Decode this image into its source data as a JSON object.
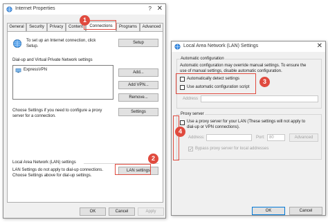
{
  "internet_properties": {
    "title": "Internet Properties",
    "help_glyph": "?",
    "close_glyph": "✕",
    "tabs": [
      {
        "label": "General"
      },
      {
        "label": "Security"
      },
      {
        "label": "Privacy"
      },
      {
        "label": "Content"
      },
      {
        "label": "Connections"
      },
      {
        "label": "Programs"
      },
      {
        "label": "Advanced"
      }
    ],
    "setup_text_1": "To set up an Internet connection, click",
    "setup_text_2": "Setup.",
    "setup_button": "Setup",
    "dialup_heading": "Dial-up and Virtual Private Network settings",
    "vpn_item": "ExpressVPN",
    "add_button": "Add...",
    "add_vpn_button": "Add VPN...",
    "remove_button": "Remove...",
    "settings_button": "Settings",
    "proxy_text_1": "Choose Settings if you need to configure a proxy",
    "proxy_text_2": "server for a connection.",
    "lan_heading": "Local Area Network (LAN) settings",
    "lan_text_1": "LAN Settings do not apply to dial-up connections.",
    "lan_text_2": "Choose Settings above for dial-up settings.",
    "lan_button": "LAN settings",
    "ok_button": "OK",
    "cancel_button": "Cancel",
    "apply_button": "Apply"
  },
  "lan_dialog": {
    "title": "Local Area Network (LAN) Settings",
    "close_glyph": "✕",
    "auto_config_heading": "Automatic configuration",
    "auto_config_text_1": "Automatic configuration may override manual settings. To ensure the",
    "auto_config_text_2": "use of manual settings, disable automatic configuration.",
    "auto_detect_label": "Automatically detect settings",
    "auto_detect_checked": false,
    "use_script_label": "Use automatic configuration script",
    "use_script_checked": false,
    "address_label": "Address",
    "proxy_heading": "Proxy server",
    "use_proxy_label_1": "Use a proxy server for your LAN (These settings will not apply to",
    "use_proxy_label_2": "dial-up or VPN connections).",
    "use_proxy_checked": false,
    "proxy_address_label": "Address:",
    "port_label": "Port:",
    "port_value": "80",
    "advanced_button": "Advanced",
    "bypass_label": "Bypass proxy server for local addresses",
    "bypass_checked": true,
    "ok_button": "OK",
    "cancel_button": "Cancel"
  },
  "annotations": {
    "step1": "1",
    "step2": "2",
    "step3": "3",
    "step4": "4",
    "color": "#e04a3e"
  }
}
